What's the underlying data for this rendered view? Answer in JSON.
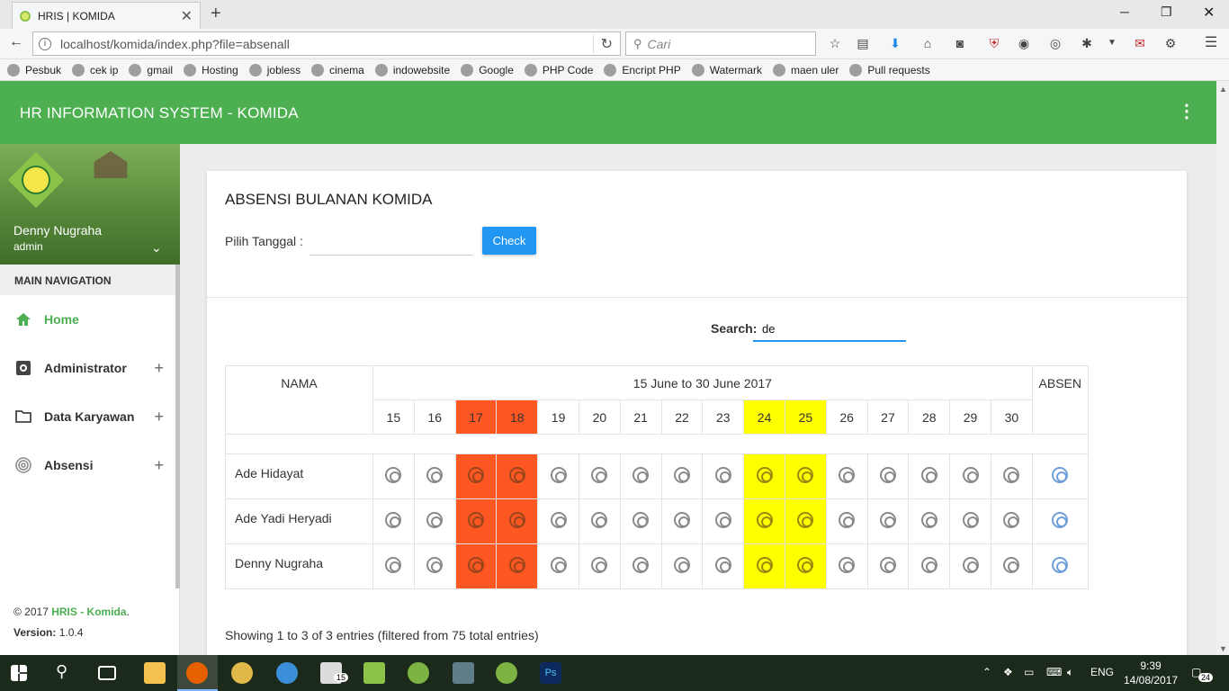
{
  "browser": {
    "tab_title": "HRIS | KOMIDA",
    "url": "localhost/komida/index.php?file=absenall",
    "search_placeholder": "Cari",
    "bookmarks": [
      "Pesbuk",
      "cek ip",
      "gmail",
      "Hosting",
      "jobless",
      "cinema",
      "indowebsite",
      "Google",
      "PHP Code",
      "Encript PHP",
      "Watermark",
      "maen uler",
      "Pull requests"
    ]
  },
  "header": {
    "brand": "HR INFORMATION SYSTEM - KOMIDA"
  },
  "sidebar": {
    "user_name": "Denny Nugraha",
    "user_role": "admin",
    "nav_header": "MAIN NAVIGATION",
    "items": [
      {
        "label": "Home",
        "icon": "home-icon"
      },
      {
        "label": "Administrator",
        "icon": "gear-icon"
      },
      {
        "label": "Data Karyawan",
        "icon": "folder-icon"
      },
      {
        "label": "Absensi",
        "icon": "fingerprint-icon"
      }
    ],
    "footer_prefix": "© 2017 ",
    "footer_brand": "HRIS - Komida",
    "footer_suffix": ".",
    "version_label": "Version:",
    "version_value": "1.0.4"
  },
  "main": {
    "title": "ABSENSI BULANAN KOMIDA",
    "date_label": "Pilih Tanggal :",
    "check_button": "Check",
    "search_label": "Search:",
    "search_value": "de",
    "table": {
      "col_name": "NAMA",
      "range": "15 June to 30 June 2017",
      "col_absen": "ABSEN",
      "days": [
        {
          "d": "15",
          "mark": ""
        },
        {
          "d": "16",
          "mark": ""
        },
        {
          "d": "17",
          "mark": "red"
        },
        {
          "d": "18",
          "mark": "red"
        },
        {
          "d": "19",
          "mark": ""
        },
        {
          "d": "20",
          "mark": ""
        },
        {
          "d": "21",
          "mark": ""
        },
        {
          "d": "22",
          "mark": ""
        },
        {
          "d": "23",
          "mark": ""
        },
        {
          "d": "24",
          "mark": "yellow"
        },
        {
          "d": "25",
          "mark": "yellow"
        },
        {
          "d": "26",
          "mark": ""
        },
        {
          "d": "27",
          "mark": ""
        },
        {
          "d": "28",
          "mark": ""
        },
        {
          "d": "29",
          "mark": ""
        },
        {
          "d": "30",
          "mark": ""
        }
      ],
      "rows": [
        {
          "name": "Ade Hidayat"
        },
        {
          "name": "Ade Yadi Heryadi"
        },
        {
          "name": "Denny Nugraha"
        }
      ]
    },
    "entries_info": "Showing 1 to 3 of 3 entries (filtered from 75 total entries)"
  },
  "taskbar": {
    "lang": "ENG",
    "time": "9:39",
    "date": "14/08/2017",
    "notif_count": "24",
    "mail_badge": "15"
  },
  "colors": {
    "header": "#4caf50",
    "weekend_red": "#ff5722",
    "holiday_yellow": "#ffff00",
    "button": "#2196f3"
  }
}
